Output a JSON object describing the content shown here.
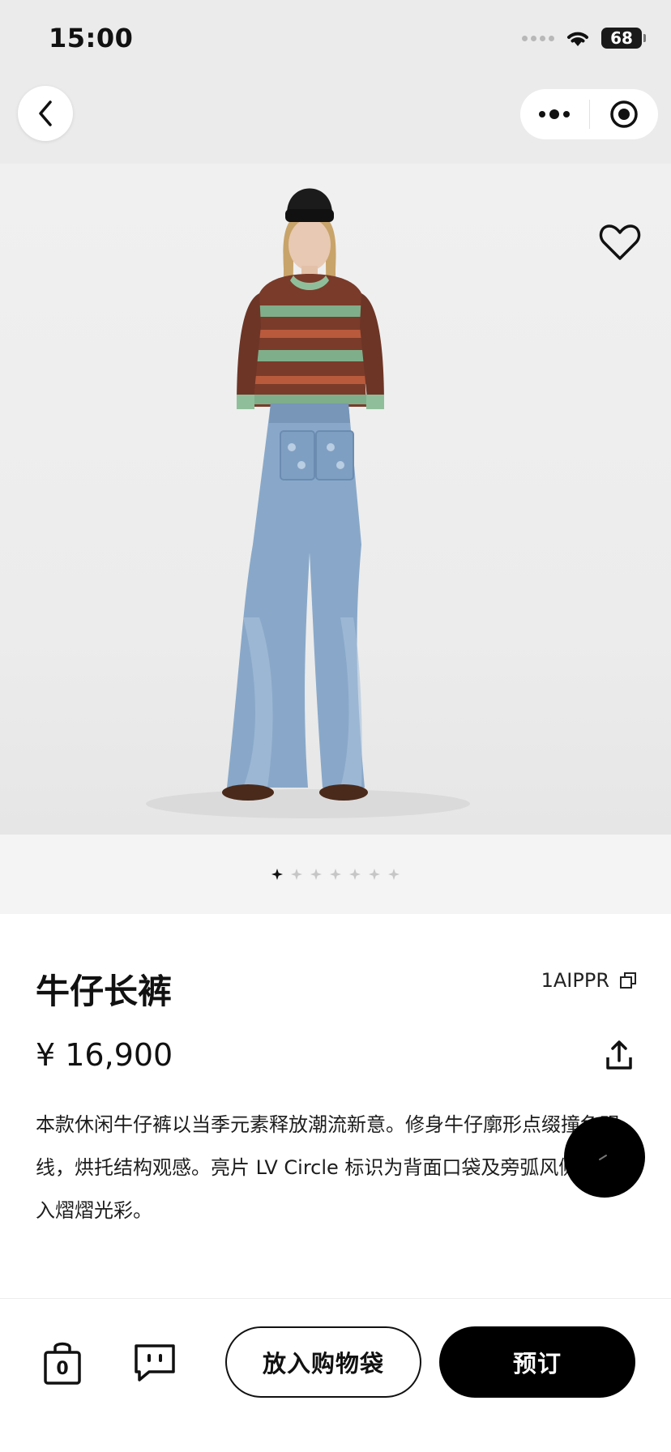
{
  "status_bar": {
    "time": "15:00",
    "battery": "68"
  },
  "nav": {
    "back_icon": "chevron-left-icon",
    "more_icon": "more-dots-icon",
    "close_icon": "target-icon"
  },
  "product": {
    "title": "牛仔长裤",
    "sku": "1AIPPR",
    "price": "¥ 16,900",
    "description": "本款休闲牛仔裤以当季元素释放潮流新意。修身牛仔廓形点缀撞色明线，烘托结构观感。亮片 LV Circle 标识为背面口袋及旁弧风侧袋注入熠熠光彩。",
    "image_count": 7,
    "active_image": 1
  },
  "bottom_bar": {
    "bag_count": "0",
    "add_to_bag_label": "放入购物袋",
    "order_label": "预订"
  },
  "colors": {
    "accent": "#000000",
    "background": "#ffffff",
    "header_bg": "#ebebeb"
  }
}
